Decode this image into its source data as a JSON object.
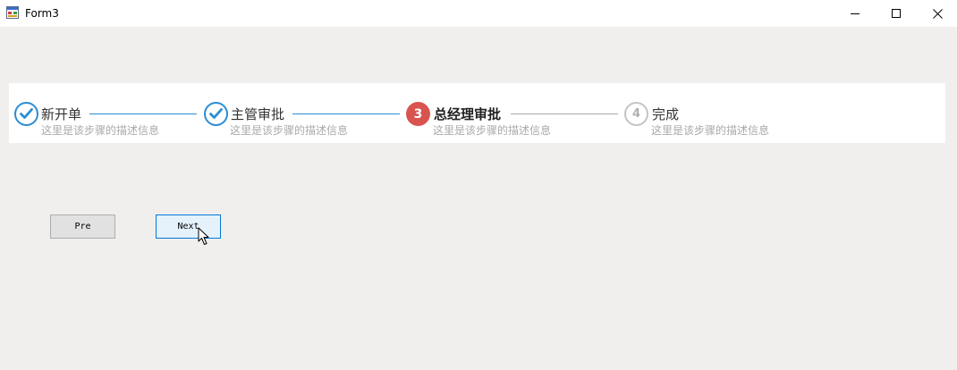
{
  "window": {
    "title": "Form3"
  },
  "steps": [
    {
      "number": "1",
      "title": "新开单",
      "description": "这里是该步骤的描述信息",
      "state": "done"
    },
    {
      "number": "2",
      "title": "主管审批",
      "description": "这里是该步骤的描述信息",
      "state": "done"
    },
    {
      "number": "3",
      "title": "总经理审批",
      "description": "这里是该步骤的描述信息",
      "state": "active"
    },
    {
      "number": "4",
      "title": "完成",
      "description": "这里是该步骤的描述信息",
      "state": "pending"
    }
  ],
  "buttons": {
    "pre_label": "Pre",
    "next_label": "Next"
  },
  "colors": {
    "done": "#2a8dd4",
    "active": "#d9534f",
    "pending": "#a9a9a9"
  },
  "icons": {
    "app": "form-app-icon",
    "check": "check-icon",
    "cursor": "mouse-pointer-icon"
  }
}
